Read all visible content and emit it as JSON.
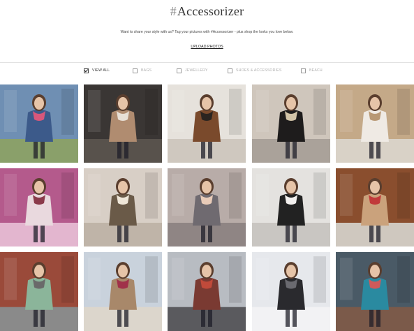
{
  "brand": {
    "hash": "#",
    "name": "Accessorizer"
  },
  "tagline": "Want to share your style with us? Tag your pictures with #Accessorizer - plus shop the looks you love below.",
  "upload_label": "UPLOAD PHOTOS",
  "filters": [
    {
      "label": "VIEW ALL",
      "checked": true
    },
    {
      "label": "BAGS",
      "checked": false
    },
    {
      "label": "JEWELLERY",
      "checked": false
    },
    {
      "label": "SHOES & ACCESSORIES",
      "checked": false
    },
    {
      "label": "BEACH",
      "checked": false
    }
  ],
  "photos": [
    {
      "name": "photo-woman-pink-coat-lake",
      "bg": "#6f8fb3",
      "ground": "#8aa06a",
      "coat": "#3c5a8a",
      "scarf": "#d8577b"
    },
    {
      "name": "photo-woman-camel-coat-street",
      "bg": "#3a3634",
      "ground": "#58524c",
      "coat": "#b08c70",
      "scarf": "#e8e0d6"
    },
    {
      "name": "photo-woman-brown-coat-pillars",
      "bg": "#e6e2dc",
      "ground": "#cfc8bf",
      "coat": "#7a4a2c",
      "scarf": "#2a2420"
    },
    {
      "name": "photo-woman-black-top-bag",
      "bg": "#cfc6bc",
      "ground": "#aaa29a",
      "coat": "#1e1c1c",
      "scarf": "#d2c4a8"
    },
    {
      "name": "photo-woman-beige-trousers-tiles",
      "bg": "#c4a988",
      "ground": "#d9d2c7",
      "coat": "#efeae4",
      "scarf": "#b89874"
    },
    {
      "name": "photo-woman-bobble-hat-carousel",
      "bg": "#b45a8c",
      "ground": "#e3b6cf",
      "coat": "#e9d9de",
      "scarf": "#8a3a4a"
    },
    {
      "name": "photo-woman-cream-beanie-leopard",
      "bg": "#d8cfc6",
      "ground": "#bfb4a8",
      "coat": "#6a5a48",
      "scarf": "#efe6d8"
    },
    {
      "name": "photo-woman-offshoulder-top",
      "bg": "#b8aca8",
      "ground": "#8f8584",
      "coat": "#6f6a70",
      "scarf": "#e8cbb8"
    },
    {
      "name": "photo-woman-white-door-black",
      "bg": "#e4e2df",
      "ground": "#c9c6c2",
      "coat": "#222222",
      "scarf": "#f2f0ee"
    },
    {
      "name": "photo-woman-wooden-door-camel",
      "bg": "#8a4e2e",
      "ground": "#cfc8bf",
      "coat": "#caa27c",
      "scarf": "#c13a3a"
    },
    {
      "name": "photo-woman-green-jumper-brick",
      "bg": "#9a4a3a",
      "ground": "#8a8a8a",
      "coat": "#8bb59a",
      "scarf": "#6a6a6a"
    },
    {
      "name": "photo-woman-checked-coat-house",
      "bg": "#c9d2dc",
      "ground": "#dcd6cc",
      "coat": "#a8886a",
      "scarf": "#a0324a"
    },
    {
      "name": "photo-woman-tartan-scarf-river",
      "bg": "#b8bcc2",
      "ground": "#5a5a5e",
      "coat": "#7a3a32",
      "scarf": "#c04a3a"
    },
    {
      "name": "photo-woman-grey-cap-snow",
      "bg": "#e6e8ec",
      "ground": "#f2f2f4",
      "coat": "#2a2a2e",
      "scarf": "#6a6a70"
    },
    {
      "name": "photo-woman-green-dress-flowers",
      "bg": "#4a5a66",
      "ground": "#7b5a4a",
      "coat": "#2a8aa0",
      "scarf": "#d05a5a"
    }
  ]
}
